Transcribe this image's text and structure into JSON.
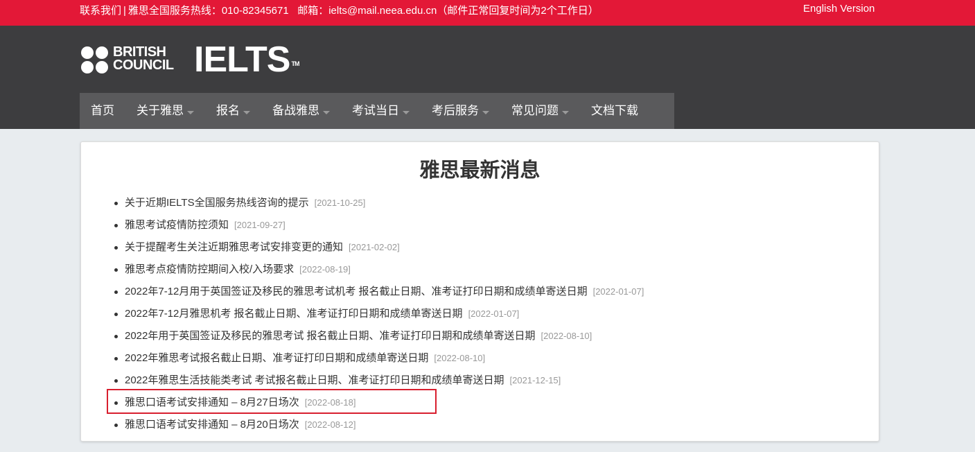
{
  "topbar": {
    "contact_label": "联系我们",
    "separator": "|",
    "hotline_text": "雅思全国服务热线：010-82345671",
    "email_label": "邮箱：",
    "email": "ielts@mail.neea.edu.cn",
    "reply_note": "（邮件正常回复时间为2个工作日）",
    "english_version": "English Version",
    "background_color": "#e31837"
  },
  "header": {
    "bc_logo_line1": "BRITISH",
    "bc_logo_line2": "COUNCIL",
    "ielts_logo_text": "IELTS",
    "ielts_logo_tm": "TM",
    "background_color": "#3d3d3f"
  },
  "nav": {
    "items": [
      {
        "label": "首页",
        "has_dropdown": false
      },
      {
        "label": "关于雅思",
        "has_dropdown": true
      },
      {
        "label": "报名",
        "has_dropdown": true
      },
      {
        "label": "备战雅思",
        "has_dropdown": true
      },
      {
        "label": "考试当日",
        "has_dropdown": true
      },
      {
        "label": "考后服务",
        "has_dropdown": true
      },
      {
        "label": "常见问题",
        "has_dropdown": true
      },
      {
        "label": "文档下载",
        "has_dropdown": false
      }
    ],
    "background_color": "#5a5a5c"
  },
  "main": {
    "title": "雅思最新消息",
    "news": [
      {
        "title": "关于近期IELTS全国服务热线咨询的提示",
        "date": "[2021-10-25]"
      },
      {
        "title": "雅思考试疫情防控须知",
        "date": "[2021-09-27]"
      },
      {
        "title": "关于提醒考生关注近期雅思考试安排变更的通知",
        "date": "[2021-02-02]"
      },
      {
        "title": "雅思考点疫情防控期间入校/入场要求",
        "date": "[2022-08-19]"
      },
      {
        "title": "2022年7-12月用于英国签证及移民的雅思考试机考 报名截止日期、准考证打印日期和成绩单寄送日期",
        "date": "[2022-01-07]"
      },
      {
        "title": "2022年7-12月雅思机考 报名截止日期、准考证打印日期和成绩单寄送日期",
        "date": "[2022-01-07]"
      },
      {
        "title": "2022年用于英国签证及移民的雅思考试 报名截止日期、准考证打印日期和成绩单寄送日期",
        "date": "[2022-08-10]"
      },
      {
        "title": "2022年雅思考试报名截止日期、准考证打印日期和成绩单寄送日期",
        "date": "[2022-08-10]"
      },
      {
        "title": "2022年雅思生活技能类考试 考试报名截止日期、准考证打印日期和成绩单寄送日期",
        "date": "[2021-12-15]"
      },
      {
        "title": "雅思口语考试安排通知 – 8月27日场次",
        "date": "[2022-08-18]"
      },
      {
        "title": "雅思口语考试安排通知 – 8月20日场次",
        "date": "[2022-08-12]"
      }
    ],
    "highlight_color": "#d81e2e"
  }
}
